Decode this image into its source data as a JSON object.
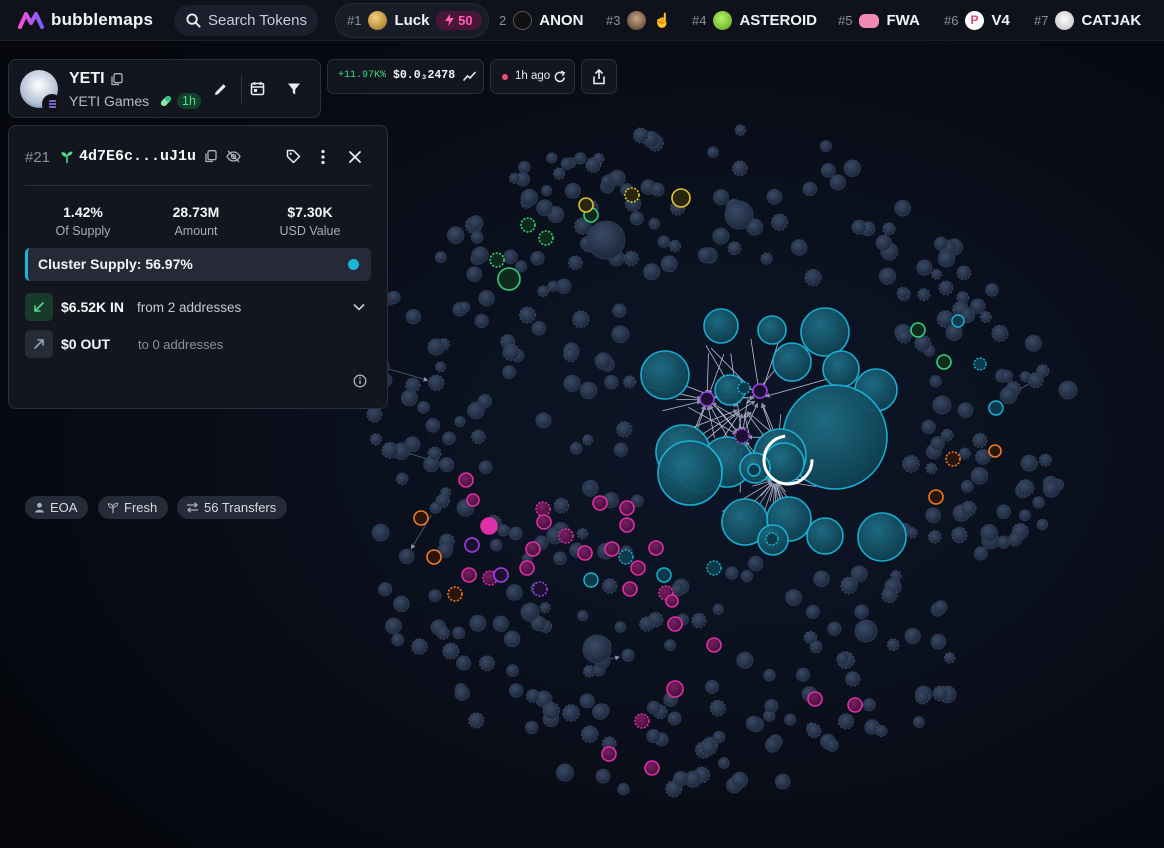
{
  "header": {
    "brand": "bubblemaps",
    "search_placeholder": "Search Tokens",
    "trending": [
      {
        "rank": "#1",
        "name": "Luck",
        "boost": "50",
        "avatar_color": "#b98a2e"
      },
      {
        "rank": "2",
        "name": "ANON",
        "avatar_color": "#111111"
      },
      {
        "rank": "#3",
        "name": "",
        "avatar_color": "#8d6b55"
      },
      {
        "rank": "#4",
        "name": "ASTEROID",
        "avatar_color": "#7ed321"
      },
      {
        "rank": "#5",
        "name": "FWA",
        "avatar_color": "#f08ab2"
      },
      {
        "rank": "#6",
        "name": "V4",
        "avatar_color": "#ffffff"
      },
      {
        "rank": "#7",
        "name": "CATJAK",
        "avatar_color": "#e6e6e6"
      }
    ]
  },
  "token": {
    "symbol": "YETI",
    "name": "YETI Games",
    "age": "1h",
    "price_change": "+11.97K%",
    "price": "$0.0₃2478",
    "updated": "1h ago"
  },
  "detail": {
    "rank": "#21",
    "address": "4d7E6c...uJ1u",
    "supply_pct": "1.42%",
    "supply_label": "Of Supply",
    "amount": "28.73M",
    "amount_label": "Amount",
    "usd_value": "$7.30K",
    "usd_label": "USD Value",
    "cluster_supply": "Cluster Supply: 56.97%",
    "cluster_color": "#19b6da",
    "in_amount": "$6.52K IN",
    "in_from": "from 2 addresses",
    "out_amount": "$0 OUT",
    "out_to": "to 0 addresses",
    "tags": [
      "EOA",
      "Fresh",
      "56 Transfers"
    ]
  },
  "colors": {
    "accent_pink": "#ff4fb0",
    "cluster_cyan": "#19b6da",
    "positive": "#38d97c"
  }
}
